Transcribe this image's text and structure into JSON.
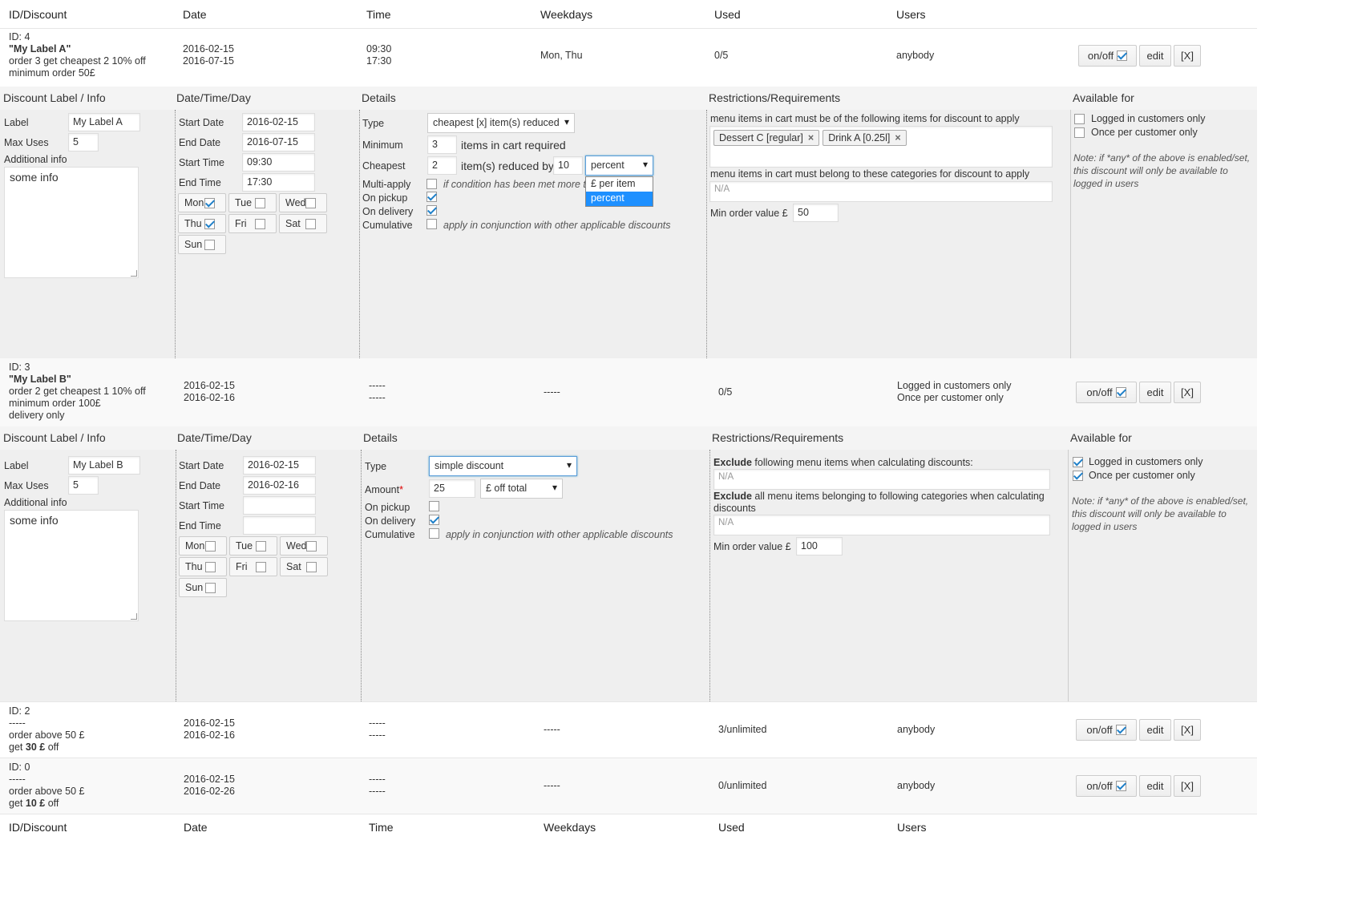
{
  "columns": {
    "id": "ID/Discount",
    "date": "Date",
    "time": "Time",
    "weekdays": "Weekdays",
    "used": "Used",
    "users": "Users"
  },
  "buttons": {
    "onoff": "on/off",
    "edit": "edit",
    "delete": "[X]"
  },
  "panel_headers": {
    "label": "Discount Label / Info",
    "datetime": "Date/Time/Day",
    "details": "Details",
    "restrictions": "Restrictions/Requirements",
    "available": "Available for"
  },
  "form_labels": {
    "label": "Label",
    "max_uses": "Max Uses",
    "additional_info": "Additional info",
    "start_date": "Start Date",
    "end_date": "End Date",
    "start_time": "Start Time",
    "end_time": "End Time",
    "type": "Type",
    "minimum": "Minimum",
    "cheapest": "Cheapest",
    "multi_apply": "Multi-apply",
    "on_pickup": "On pickup",
    "on_delivery": "On delivery",
    "cumulative": "Cumulative",
    "amount": "Amount",
    "min_order": "Min order value £",
    "logged_in": "Logged in customers only",
    "once_per": "Once per customer only",
    "note": "Note: if *any* of the above is enabled/set, this discount will only be available to logged in users",
    "cumulative_hint": "apply in conjunction with other applicable discounts",
    "multi_hint": "if condition has been met more ti",
    "items_in_cart": "items in cart required",
    "items_reduced": "item(s) reduced by",
    "exclude_bold": "Exclude",
    "exclude_items": "following menu items when calculating discounts:",
    "exclude_cats": "all menu items belonging to following categories when calculating discounts",
    "must_items": "menu items in cart must be of the following items for discount to apply",
    "must_cats": "menu items in cart must belong to these categories for discount to apply",
    "na": "N/A",
    "required_mark": "*"
  },
  "days": [
    "Mon",
    "Tue",
    "Wed",
    "Thu",
    "Fri",
    "Sat",
    "Sun"
  ],
  "row4": {
    "id": "ID: 4",
    "label": "\"My Label A\"",
    "desc1": "order 3 get cheapest 2 10% off",
    "desc2": "minimum order 50£",
    "date1": "2016-02-15",
    "date2": "2016-07-15",
    "time1": "09:30",
    "time2": "17:30",
    "weekdays": "Mon, Thu",
    "used": "0/5",
    "users": "anybody"
  },
  "panel4": {
    "label": "My Label A",
    "max_uses": "5",
    "info": "some info",
    "start_date": "2016-02-15",
    "end_date": "2016-07-15",
    "start_time": "09:30",
    "end_time": "17:30",
    "type": "cheapest [x] item(s) reduced",
    "minimum": "3",
    "cheapest": "2",
    "reduced_by": "10",
    "unit": "percent",
    "unit_options": [
      "£ per item",
      "percent"
    ],
    "tags": [
      "Dessert C [regular]",
      "Drink A [0.25l]"
    ],
    "min_order": "50"
  },
  "row3": {
    "id": "ID: 3",
    "label": "\"My Label B\"",
    "desc1": "order 2 get cheapest 1 10% off",
    "desc2": "minimum order 100£",
    "desc3": "delivery only",
    "date1": "2016-02-15",
    "date2": "2016-02-16",
    "time1": "-----",
    "time2": "-----",
    "weekdays": "-----",
    "used": "0/5",
    "users1": "Logged in customers only",
    "users2": "Once per customer only"
  },
  "panel3": {
    "label": "My Label B",
    "max_uses": "5",
    "info": "some info",
    "start_date": "2016-02-15",
    "end_date": "2016-02-16",
    "type": "simple discount",
    "amount": "25",
    "amount_type": "£ off total",
    "min_order": "100"
  },
  "row2": {
    "id": "ID: 2",
    "dash": "-----",
    "desc1": "order above 50 £",
    "get": "get",
    "value": "30 £",
    "off": "off",
    "date1": "2016-02-15",
    "date2": "2016-02-16",
    "time1": "-----",
    "time2": "-----",
    "weekdays": "-----",
    "used": "3/unlimited",
    "users": "anybody"
  },
  "row0": {
    "id": "ID: 0",
    "dash": "-----",
    "desc1": "order above 50 £",
    "get": "get",
    "value": "10 £",
    "off": "off",
    "date1": "2016-02-15",
    "date2": "2016-02-26",
    "time1": "-----",
    "time2": "-----",
    "weekdays": "-----",
    "used": "0/unlimited",
    "users": "anybody"
  }
}
